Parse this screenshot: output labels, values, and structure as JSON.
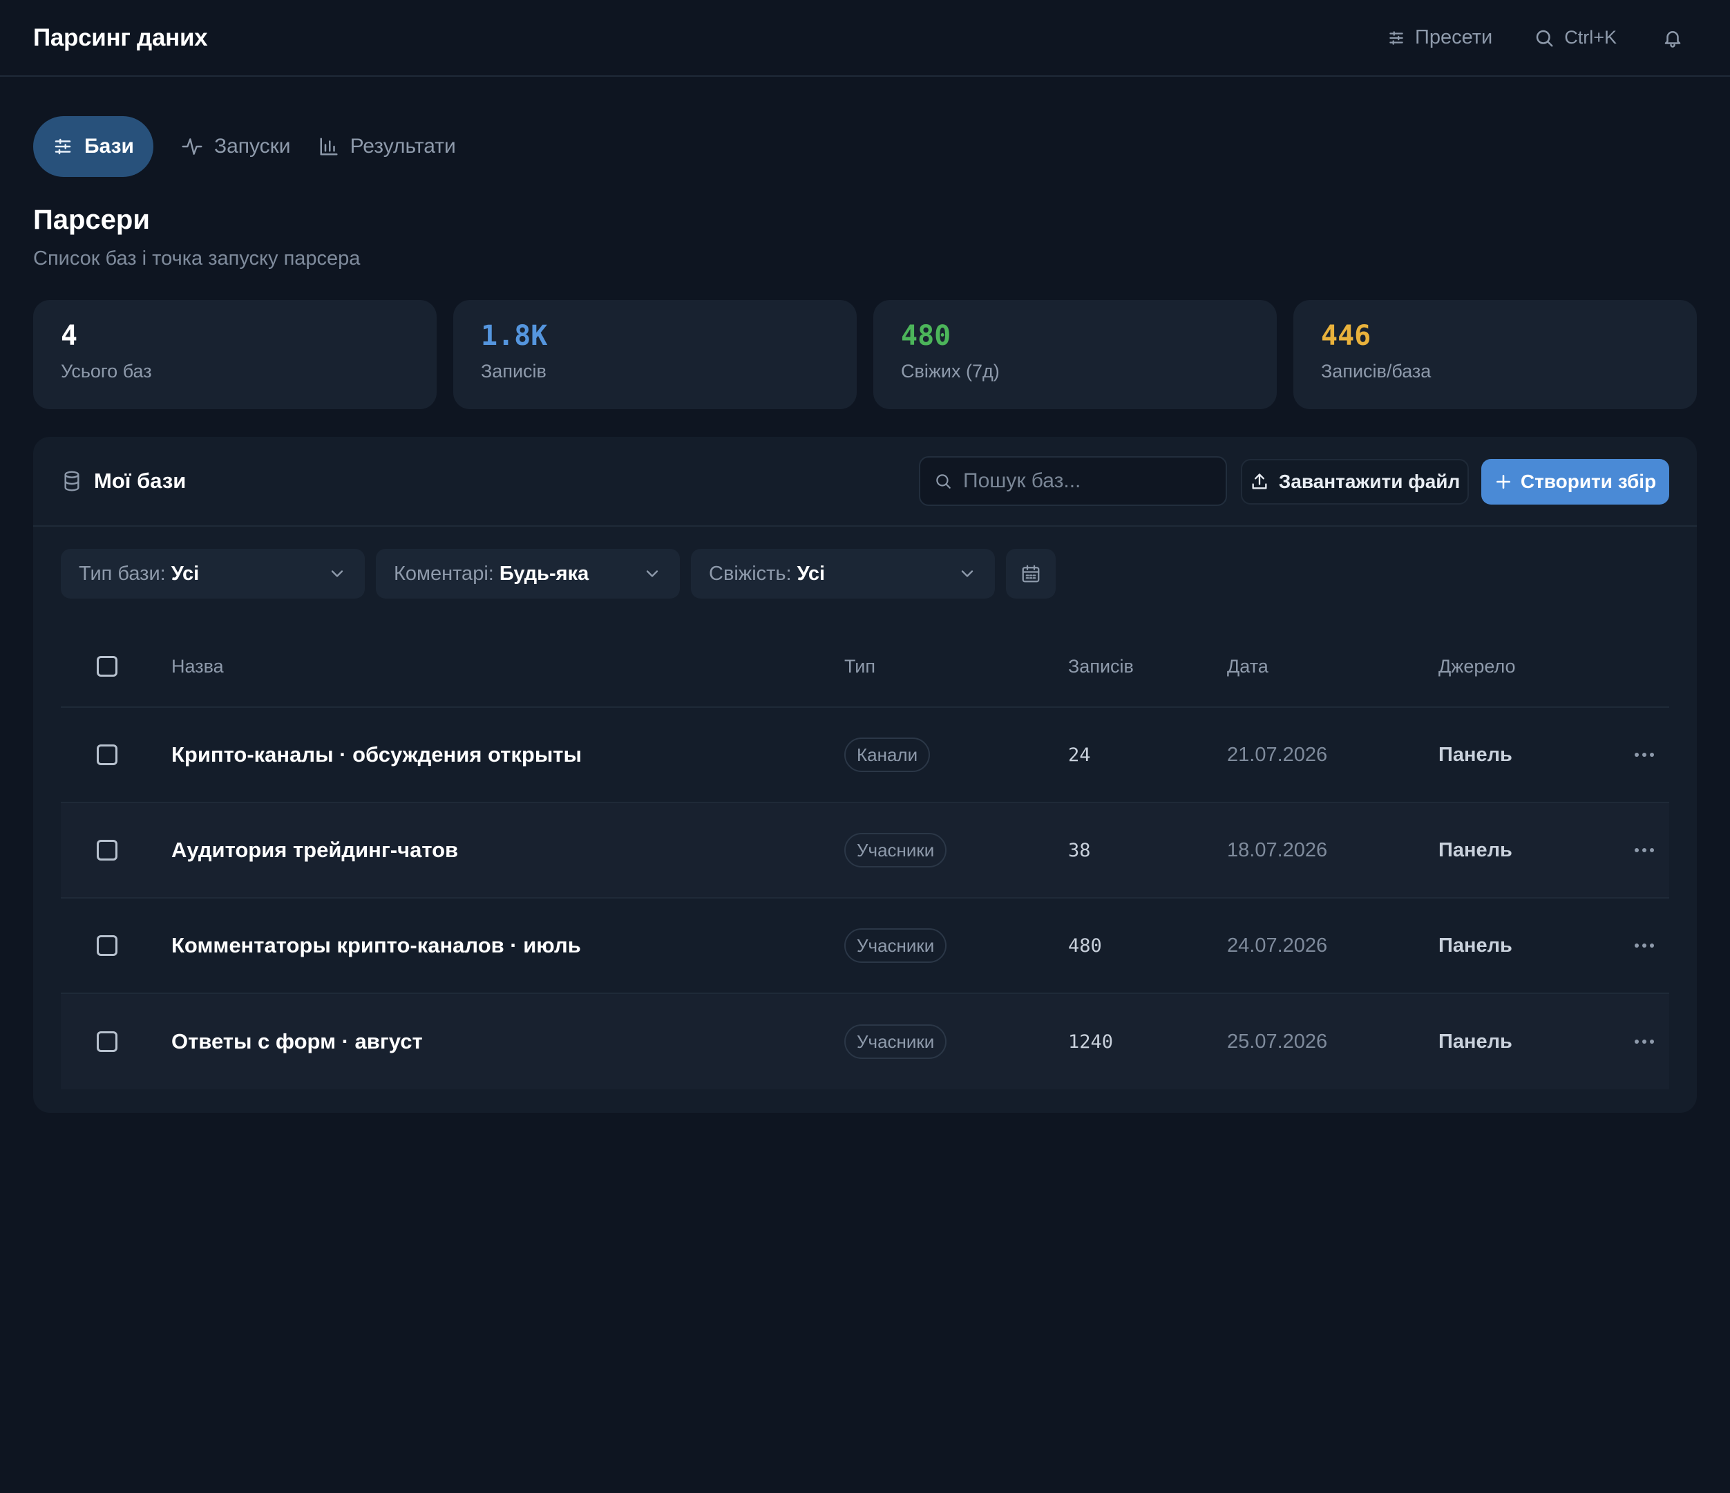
{
  "header": {
    "title": "Парсинг даних",
    "presets_label": "Пресети",
    "search_shortcut": "Ctrl+K",
    "presets_icon": "sliders-icon",
    "search_icon": "search-icon",
    "bell_icon": "bell-icon"
  },
  "tabs": [
    {
      "label": "Бази",
      "icon": "sliders-icon",
      "active": true
    },
    {
      "label": "Запуски",
      "icon": "activity-icon",
      "active": false
    },
    {
      "label": "Результати",
      "icon": "bar-chart-icon",
      "active": false
    }
  ],
  "page": {
    "title": "Парсери",
    "subtitle": "Список баз і точка запуску парсера"
  },
  "stats": [
    {
      "value": "4",
      "label": "Усього баз",
      "color": "#ffffff"
    },
    {
      "value": "1.8K",
      "label": "Записів",
      "color": "#5596de"
    },
    {
      "value": "480",
      "label": "Свіжих (7д)",
      "color": "#4cb55a"
    },
    {
      "value": "446",
      "label": "Записів/база",
      "color": "#e9b23c"
    }
  ],
  "panel": {
    "title": "Мої бази",
    "title_icon": "database-icon",
    "search_placeholder": "Пошук баз...",
    "upload_label": "Завантажити файл",
    "upload_icon": "upload-icon",
    "create_label": "Створити збір",
    "create_icon": "plus-icon"
  },
  "filters": [
    {
      "label": "Тип бази:",
      "value": "Усі"
    },
    {
      "label": "Коментарі:",
      "value": "Будь-яка"
    },
    {
      "label": "Свіжість:",
      "value": "Усі"
    }
  ],
  "calendar_icon": "calendar-icon",
  "table": {
    "columns": [
      "Назва",
      "Тип",
      "Записів",
      "Дата",
      "Джерело"
    ],
    "rows": [
      {
        "name": "Крипто-каналы · обсуждения открыты",
        "type": "Канали",
        "count": "24",
        "date": "21.07.2026",
        "source": "Панель"
      },
      {
        "name": "Аудитория трейдинг-чатов",
        "type": "Учасники",
        "count": "38",
        "date": "18.07.2026",
        "source": "Панель"
      },
      {
        "name": "Комментаторы крипто-каналов · июль",
        "type": "Учасники",
        "count": "480",
        "date": "24.07.2026",
        "source": "Панель"
      },
      {
        "name": "Ответы с форм · август",
        "type": "Учасники",
        "count": "1240",
        "date": "25.07.2026",
        "source": "Панель"
      }
    ]
  }
}
